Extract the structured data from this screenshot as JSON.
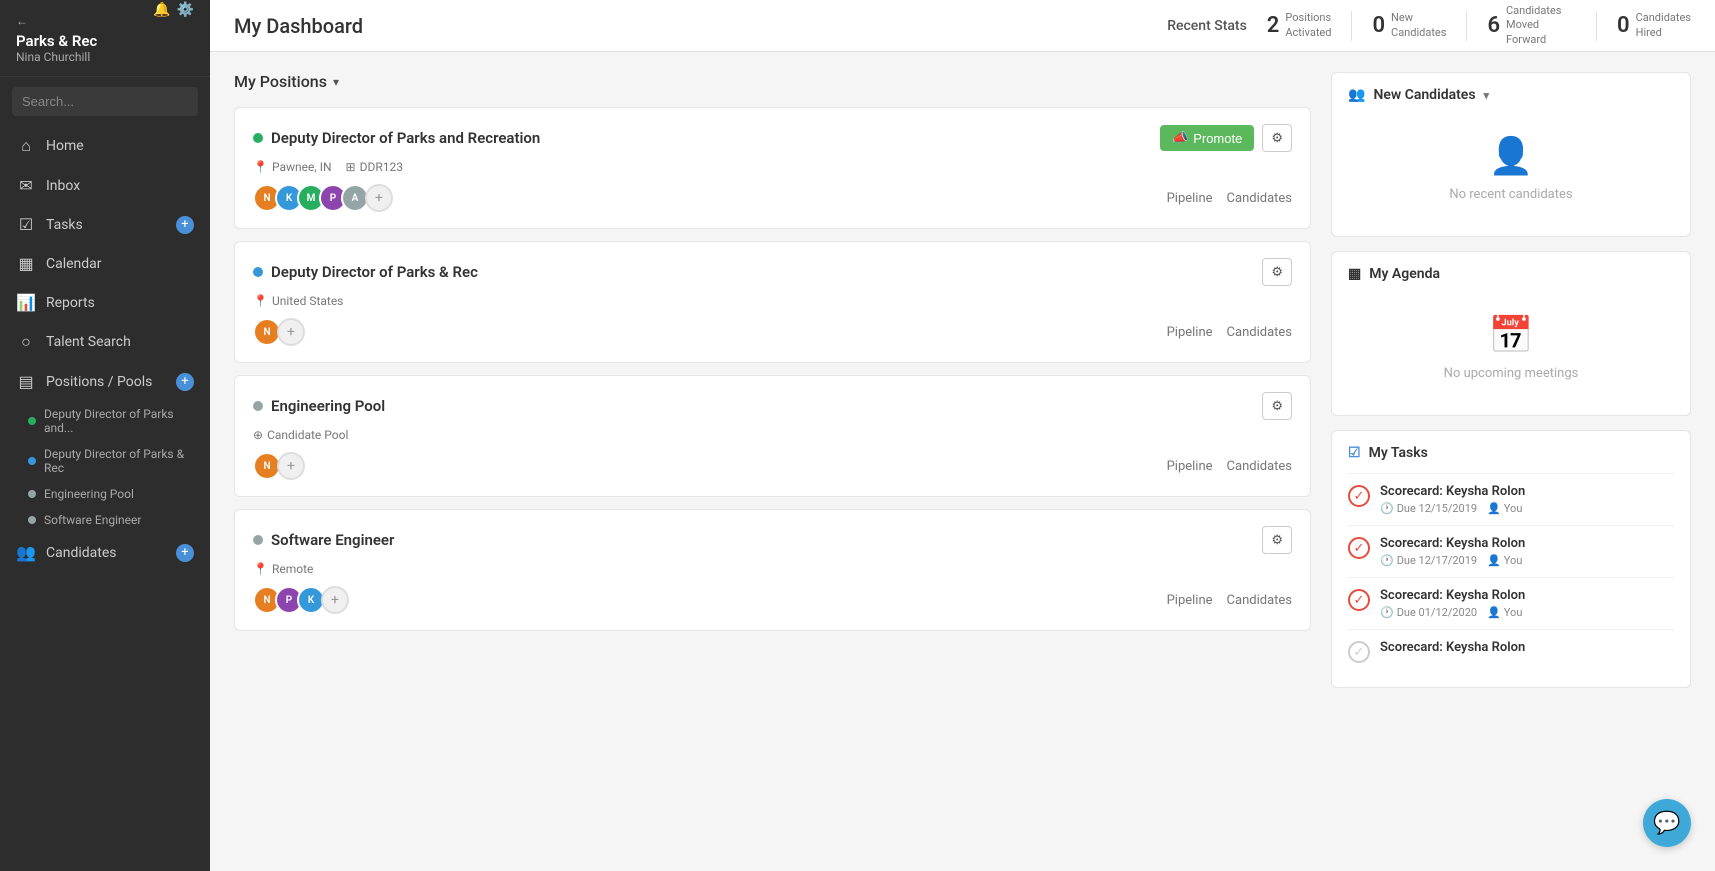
{
  "sidebar": {
    "org_name": "Parks & Rec",
    "org_user": "Nina Churchill",
    "search_placeholder": "Search...",
    "nav_items": [
      {
        "id": "home",
        "label": "Home",
        "icon": "🏠"
      },
      {
        "id": "inbox",
        "label": "Inbox",
        "icon": "✉️"
      },
      {
        "id": "tasks",
        "label": "Tasks",
        "icon": "☑️",
        "has_plus": true
      },
      {
        "id": "calendar",
        "label": "Calendar",
        "icon": "📅"
      },
      {
        "id": "reports",
        "label": "Reports",
        "icon": "📊"
      },
      {
        "id": "talent-search",
        "label": "Talent Search",
        "icon": "🔍"
      },
      {
        "id": "positions-pools",
        "label": "Positions / Pools",
        "icon": "📋",
        "has_plus": true
      }
    ],
    "sub_items": [
      {
        "id": "deputy-parks",
        "label": "Deputy Director of Parks and...",
        "color": "#27ae60"
      },
      {
        "id": "deputy-rec",
        "label": "Deputy Director of Parks & Rec",
        "color": "#3498db"
      },
      {
        "id": "engineering-pool",
        "label": "Engineering Pool",
        "color": "#95a5a6"
      },
      {
        "id": "software-engineer",
        "label": "Software Engineer",
        "color": "#95a5a6"
      }
    ],
    "candidates_label": "Candidates",
    "candidates_has_plus": true
  },
  "topbar": {
    "page_title": "My Dashboard",
    "recent_stats_label": "Recent Stats",
    "stats": [
      {
        "number": "2",
        "label": "Positions\nActivated"
      },
      {
        "number": "0",
        "label": "New\nCandidates"
      },
      {
        "number": "6",
        "label": "Candidates\nMoved Forward"
      },
      {
        "number": "0",
        "label": "Candidates\nHired"
      }
    ]
  },
  "positions": {
    "header": "My Positions",
    "items": [
      {
        "id": "deputy-director-parks",
        "status_color": "#27ae60",
        "title": "Deputy Director of Parks and Recreation",
        "location": "Pawnee, IN",
        "code": "DDR123",
        "has_promote": true,
        "avatars": [
          "#e67e22",
          "#3498db",
          "#27ae60",
          "#8e44ad",
          "#95a5a6"
        ],
        "show_pipeline": true
      },
      {
        "id": "deputy-director-rec",
        "status_color": "#3498db",
        "title": "Deputy Director of Parks & Rec",
        "location": "United States",
        "code": "",
        "has_promote": false,
        "avatars": [
          "#e67e22"
        ],
        "show_pipeline": true
      },
      {
        "id": "engineering-pool",
        "status_color": "#95a5a6",
        "title": "Engineering Pool",
        "location": "Candidate Pool",
        "location_icon": "pool",
        "has_promote": false,
        "avatars": [
          "#e67e22"
        ],
        "show_pipeline": true
      },
      {
        "id": "software-engineer",
        "status_color": "#95a5a6",
        "title": "Software Engineer",
        "location": "Remote",
        "has_promote": false,
        "avatars": [
          "#e67e22",
          "#8e44ad",
          "#3498db"
        ],
        "show_pipeline": true
      }
    ],
    "pipeline_label": "Pipeline",
    "candidates_label": "Candidates"
  },
  "right_panel": {
    "new_candidates": {
      "header": "New Candidates",
      "empty_text": "No recent candidates"
    },
    "agenda": {
      "header": "My Agenda",
      "empty_text": "No upcoming meetings"
    },
    "tasks": {
      "header": "My Tasks",
      "items": [
        {
          "title": "Scorecard: Keysha Rolon",
          "due": "Due 12/15/2019",
          "assignee": "You"
        },
        {
          "title": "Scorecard: Keysha Rolon",
          "due": "Due 12/17/2019",
          "assignee": "You"
        },
        {
          "title": "Scorecard: Keysha Rolon",
          "due": "Due 01/12/2020",
          "assignee": "You"
        },
        {
          "title": "Scorecard: Keysha Rolon",
          "due": "",
          "assignee": ""
        }
      ]
    }
  },
  "chat_button": "💬"
}
